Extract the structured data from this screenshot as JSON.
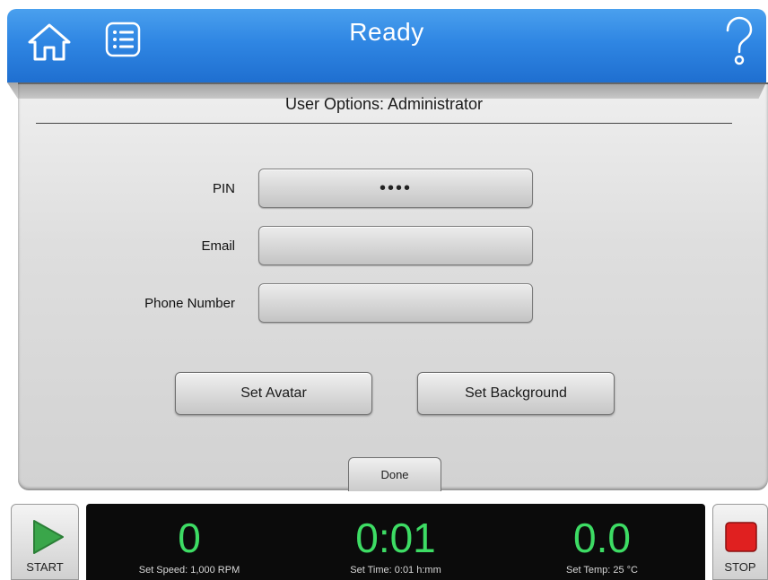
{
  "header": {
    "status": "Ready",
    "home_icon": "home-icon",
    "menu_icon": "list-icon",
    "help_icon": "help-icon",
    "accent_color": "#2f86e3"
  },
  "panel": {
    "title": "User Options: Administrator",
    "fields": {
      "pin_label": "PIN",
      "pin_value": "••••",
      "email_label": "Email",
      "email_value": "",
      "phone_label": "Phone Number",
      "phone_value": ""
    },
    "buttons": {
      "set_avatar": "Set Avatar",
      "set_background": "Set Background",
      "done": "Done"
    }
  },
  "controls": {
    "start_label": "START",
    "stop_label": "STOP",
    "start_color": "#3aa64a",
    "stop_color": "#e02020"
  },
  "readouts": {
    "speed_value": "0",
    "speed_label": "Set Speed: 1,000 RPM",
    "time_value": "0:01",
    "time_label": "Set Time: 0:01 h:mm",
    "temp_value": "0.0",
    "temp_label": "Set Temp: 25 °C",
    "value_color": "#3ddc64"
  }
}
